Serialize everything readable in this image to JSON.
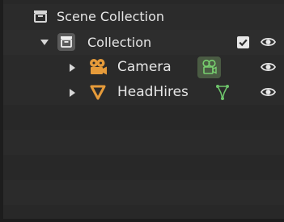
{
  "outliner": {
    "root": {
      "label": "Scene Collection",
      "icon": "scene-collection-icon"
    },
    "collection": {
      "label": "Collection",
      "icon": "collection-icon",
      "expanded": true,
      "checkbox_checked": true,
      "visible": true
    },
    "objects": [
      {
        "label": "Camera",
        "icon": "camera-object-icon",
        "data_icon": "camera-data-icon",
        "visible": true
      },
      {
        "label": "HeadHires",
        "icon": "mesh-object-icon",
        "data_icon": "mesh-data-icon",
        "visible": true
      }
    ]
  },
  "colors": {
    "object_orange": "#e69b3a",
    "data_green": "#6ec46b",
    "text": "#e6e6e6",
    "panel": "#282828",
    "selected_bg": "#4a5b43"
  }
}
